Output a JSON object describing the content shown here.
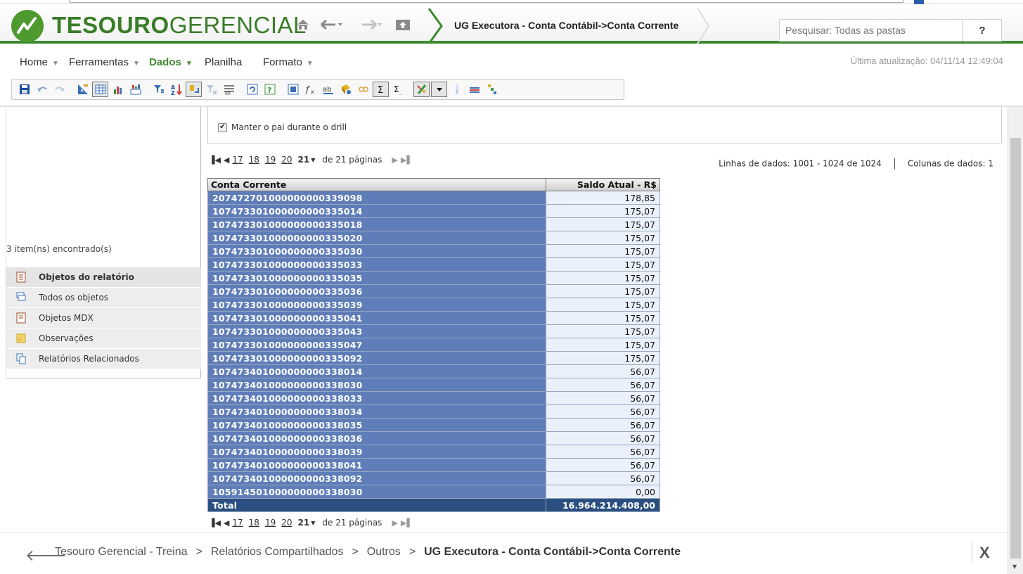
{
  "header": {
    "brand_bold": "TESOURO",
    "brand_light": "GERENCIAL",
    "report_title": "UG Executora - Conta Contábil->Conta Corrente",
    "search_placeholder": "Pesquisar: Todas as pastas",
    "help_label": "?"
  },
  "menu": {
    "items": [
      "Home",
      "Ferramentas",
      "Dados",
      "Planilha",
      "Formato"
    ],
    "last_update": "Última atualização: 04/11/14 12:49:04"
  },
  "toolbar": {
    "icons": [
      "save-icon",
      "undo-icon",
      "redo-icon",
      "design-mode-icon",
      "grid-view-icon",
      "graph-view-icon",
      "grid-graph-icon",
      "filter-icon",
      "sort-icon",
      "pivot-icon",
      "clear-filter-icon",
      "subtotals-icon",
      "refresh-icon",
      "reprompt-icon",
      "export-icon",
      "formula-icon",
      "rename-icon",
      "drill-icon",
      "link-icon",
      "sum-icon",
      "subtotal-sum-icon",
      "format-icon",
      "dropdown-icon",
      "thresholds-icon",
      "banding-icon",
      "outline-icon"
    ],
    "accent": "#3c8a2e"
  },
  "left_panel": {
    "found_text": "3 item(ns) encontrado(s)",
    "objects": [
      {
        "label": "Objetos do relatório",
        "icon": "report-objects-icon"
      },
      {
        "label": "Todos os objetos",
        "icon": "all-objects-icon"
      },
      {
        "label": "Objetos MDX",
        "icon": "mdx-objects-icon"
      },
      {
        "label": "Observações",
        "icon": "notes-icon"
      },
      {
        "label": "Relatórios Relacionados",
        "icon": "related-reports-icon"
      }
    ]
  },
  "content": {
    "drill_checkbox_label": "Manter o pai durante o drill",
    "pager": {
      "pages": [
        "17",
        "18",
        "19",
        "20"
      ],
      "current": "21",
      "of_text": "de 21 páginas"
    },
    "rows_info": "Linhas de dados: 1001 - 1024 de 1024",
    "cols_info": "Colunas de dados: 1"
  },
  "grid": {
    "headers": [
      "Conta Corrente",
      "Saldo Atual - R$"
    ],
    "rows": [
      [
        "207472701000000000339098",
        "178,85"
      ],
      [
        "107473301000000000335014",
        "175,07"
      ],
      [
        "107473301000000000335018",
        "175,07"
      ],
      [
        "107473301000000000335020",
        "175,07"
      ],
      [
        "107473301000000000335030",
        "175,07"
      ],
      [
        "107473301000000000335033",
        "175,07"
      ],
      [
        "107473301000000000335035",
        "175,07"
      ],
      [
        "107473301000000000335036",
        "175,07"
      ],
      [
        "107473301000000000335039",
        "175,07"
      ],
      [
        "107473301000000000335041",
        "175,07"
      ],
      [
        "107473301000000000335043",
        "175,07"
      ],
      [
        "107473301000000000335047",
        "175,07"
      ],
      [
        "107473301000000000335092",
        "175,07"
      ],
      [
        "107473401000000000338014",
        "56,07"
      ],
      [
        "107473401000000000338030",
        "56,07"
      ],
      [
        "107473401000000000338033",
        "56,07"
      ],
      [
        "107473401000000000338034",
        "56,07"
      ],
      [
        "107473401000000000338035",
        "56,07"
      ],
      [
        "107473401000000000338036",
        "56,07"
      ],
      [
        "107473401000000000338039",
        "56,07"
      ],
      [
        "107473401000000000338041",
        "56,07"
      ],
      [
        "107473401000000000338092",
        "56,07"
      ],
      [
        "105914501000000000338030",
        "0,00"
      ]
    ],
    "total_label": "Total",
    "total_value": "16.964.214.408,00"
  },
  "footer": {
    "crumbs": [
      "Tesouro Gerencial - Treina",
      "Relatórios Compartilhados",
      "Outros"
    ],
    "current": "UG Executora - Conta Contábil->Conta Corrente",
    "separator": ">",
    "close_label": "X"
  }
}
